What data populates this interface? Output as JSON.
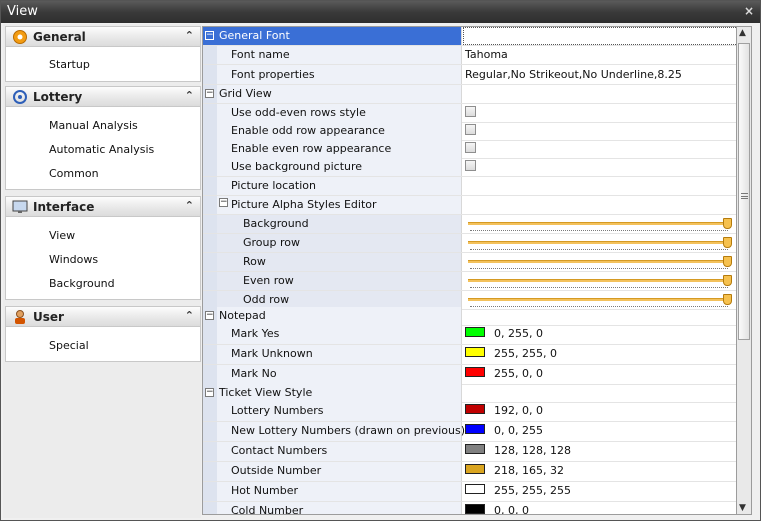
{
  "window": {
    "title": "View",
    "close_glyph": "×"
  },
  "sidebar": {
    "groups": [
      {
        "label": "General",
        "icon": "gear-icon",
        "items": [
          "Startup"
        ]
      },
      {
        "label": "Lottery",
        "icon": "lottery-icon",
        "items": [
          "Manual Analysis",
          "Automatic Analysis",
          "Common"
        ]
      },
      {
        "label": "Interface",
        "icon": "monitor-icon",
        "items": [
          "View",
          "Windows",
          "Background"
        ]
      },
      {
        "label": "User",
        "icon": "user-icon",
        "items": [
          "Special"
        ]
      }
    ],
    "collapse_glyph": "⌃"
  },
  "grid": {
    "general_font": {
      "label": "General Font",
      "font_name": {
        "label": "Font name",
        "value": "Tahoma"
      },
      "font_properties": {
        "label": "Font properties",
        "value": "Regular,No Strikeout,No Underline,8.25"
      }
    },
    "grid_view": {
      "label": "Grid View",
      "odd_even": {
        "label": "Use odd-even rows style",
        "checked": false
      },
      "odd_row": {
        "label": "Enable odd row appearance",
        "checked": false
      },
      "even_row": {
        "label": "Enable even row appearance",
        "checked": false
      },
      "background_picture": {
        "label": "Use background picture",
        "checked": false
      },
      "picture_location": {
        "label": "Picture location",
        "value": ""
      },
      "alpha_editor": {
        "label": "Picture Alpha Styles Editor",
        "background": {
          "label": "Background",
          "level": 1.0
        },
        "group_row": {
          "label": "Group row",
          "level": 1.0
        },
        "row": {
          "label": "Row",
          "level": 1.0
        },
        "even_row": {
          "label": "Even row",
          "level": 1.0
        },
        "odd_row": {
          "label": "Odd row",
          "level": 1.0
        }
      }
    },
    "notepad": {
      "label": "Notepad",
      "mark_yes": {
        "label": "Mark Yes",
        "value": "0, 255, 0",
        "color": "#00ff00"
      },
      "mark_unknown": {
        "label": "Mark Unknown",
        "value": "255, 255, 0",
        "color": "#ffff00"
      },
      "mark_no": {
        "label": "Mark No",
        "value": "255, 0, 0",
        "color": "#ff0000"
      }
    },
    "ticket_view": {
      "label": "Ticket View Style",
      "lottery_numbers": {
        "label": "Lottery Numbers",
        "value": "192, 0, 0",
        "color": "#c00000"
      },
      "new_lottery_numbers": {
        "label": "New Lottery Numbers (drawn on previous)",
        "value": "0, 0, 255",
        "color": "#0000ff"
      },
      "contact_numbers": {
        "label": "Contact Numbers",
        "value": "128, 128, 128",
        "color": "#808080"
      },
      "outside_number": {
        "label": "Outside Number",
        "value": "218, 165, 32",
        "color": "#daa520"
      },
      "hot_number": {
        "label": "Hot Number",
        "value": "255, 255, 255",
        "color": "#ffffff"
      },
      "cold_number": {
        "label": "Cold Number",
        "value": "0, 0, 0",
        "color": "#000000"
      }
    },
    "expanded_glyph": "−"
  },
  "scrollbar": {
    "up_glyph": "▲",
    "down_glyph": "▼"
  }
}
